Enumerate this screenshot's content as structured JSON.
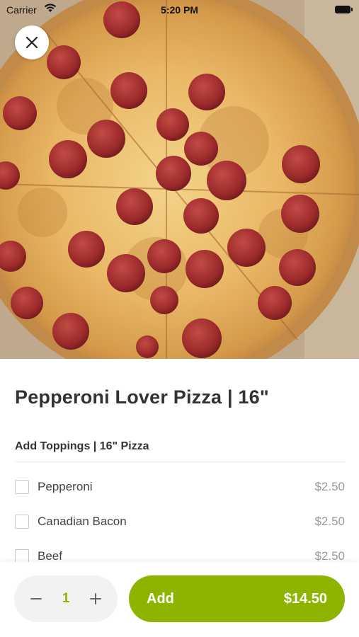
{
  "status_bar": {
    "carrier": "Carrier",
    "time": "5:20 PM"
  },
  "item": {
    "title": "Pepperoni Lover Pizza | 16\""
  },
  "toppings_section": {
    "title": "Add Toppings | 16\" Pizza",
    "options": [
      {
        "label": "Pepperoni",
        "price": "$2.50",
        "checked": false
      },
      {
        "label": "Canadian Bacon",
        "price": "$2.50",
        "checked": false
      },
      {
        "label": "Beef",
        "price": "$2.50",
        "checked": false
      }
    ]
  },
  "footer": {
    "quantity": "1",
    "add_label": "Add",
    "total": "$14.50"
  },
  "colors": {
    "accent": "#8db500",
    "text": "#333333",
    "muted": "#999999"
  },
  "icons": {
    "close": "close-icon",
    "minus": "minus-icon",
    "plus": "plus-icon",
    "wifi": "wifi-icon",
    "battery": "battery-icon"
  }
}
